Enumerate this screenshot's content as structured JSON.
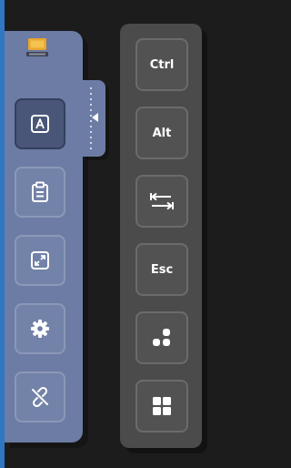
{
  "toolbar": {
    "items": [
      {
        "icon": "keyboard-icon",
        "state": "active"
      },
      {
        "icon": "clipboard-icon"
      },
      {
        "icon": "fullscreen-icon"
      },
      {
        "icon": "gear-icon"
      },
      {
        "icon": "disconnect-icon"
      }
    ]
  },
  "keys": {
    "ctrl": "Ctrl",
    "alt": "Alt",
    "tab_icon": "tab-icon",
    "esc": "Esc",
    "toggle_extra_keys_icon": "dots-icon",
    "grid_icon": "grid-icon"
  },
  "colors": {
    "accent": "#2f77c2",
    "panel": "#6c7ca4",
    "key_panel": "#4b4b4b",
    "background": "#1c1c1c"
  }
}
